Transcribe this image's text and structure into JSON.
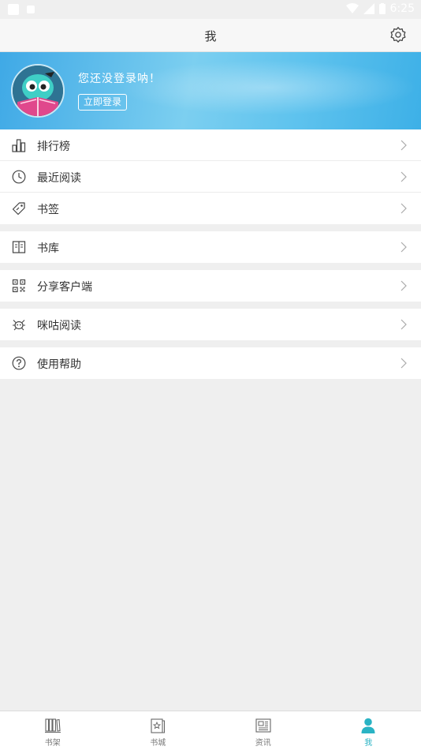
{
  "status_bar": {
    "time": "6:25"
  },
  "header": {
    "title": "我",
    "settings_icon": "gear-icon"
  },
  "profile": {
    "greeting": "您还没登录呐！",
    "login_button": "立即登录",
    "avatar_icon": "mascot-avatar"
  },
  "menu_groups": [
    [
      {
        "label": "排行榜",
        "icon": "ranking-icon"
      },
      {
        "label": "最近阅读",
        "icon": "clock-icon"
      },
      {
        "label": "书签",
        "icon": "bookmark-tag-icon"
      }
    ],
    [
      {
        "label": "书库",
        "icon": "library-icon"
      }
    ],
    [
      {
        "label": "分享客户端",
        "icon": "qr-code-icon"
      }
    ],
    [
      {
        "label": "咪咕阅读",
        "icon": "migu-icon"
      }
    ],
    [
      {
        "label": "使用帮助",
        "icon": "help-icon"
      }
    ]
  ],
  "tabs": [
    {
      "label": "书架",
      "icon": "bookshelf-icon",
      "active": false
    },
    {
      "label": "书城",
      "icon": "bookstore-icon",
      "active": false
    },
    {
      "label": "资讯",
      "icon": "news-icon",
      "active": false
    },
    {
      "label": "我",
      "icon": "person-icon",
      "active": true
    }
  ],
  "colors": {
    "accent": "#2ab3c4",
    "banner": "#5fc3ee"
  }
}
